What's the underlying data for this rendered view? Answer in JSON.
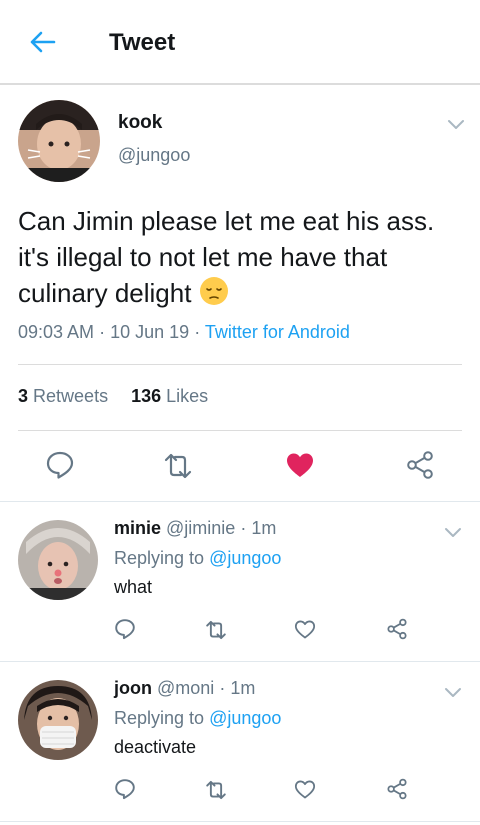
{
  "header": {
    "title": "Tweet"
  },
  "tweet": {
    "author_name": "kook",
    "author_handle": "@jungoo",
    "text": "Can Jimin please let me eat his ass. it's illegal to not let me have that culinary delight",
    "emoji": "pensive-face",
    "time": "09:03 AM",
    "date": "10 Jun 19",
    "source": "Twitter for Android",
    "retweet_count": "3",
    "retweet_label": "Retweets",
    "like_count": "136",
    "like_label": "Likes",
    "liked": true
  },
  "replies": [
    {
      "name": "minie",
      "handle": "@jiminie",
      "time": "1m",
      "replying_prefix": "Replying to",
      "replying_to": "@jungoo",
      "text": "what"
    },
    {
      "name": "joon",
      "handle": "@moni",
      "time": "1m",
      "replying_prefix": "Replying to",
      "replying_to": "@jungoo",
      "text": "deactivate"
    }
  ],
  "colors": {
    "accent": "#1da1f2",
    "like": "#e0245e",
    "muted": "#657786",
    "icon": "#657786"
  },
  "separator": "·"
}
